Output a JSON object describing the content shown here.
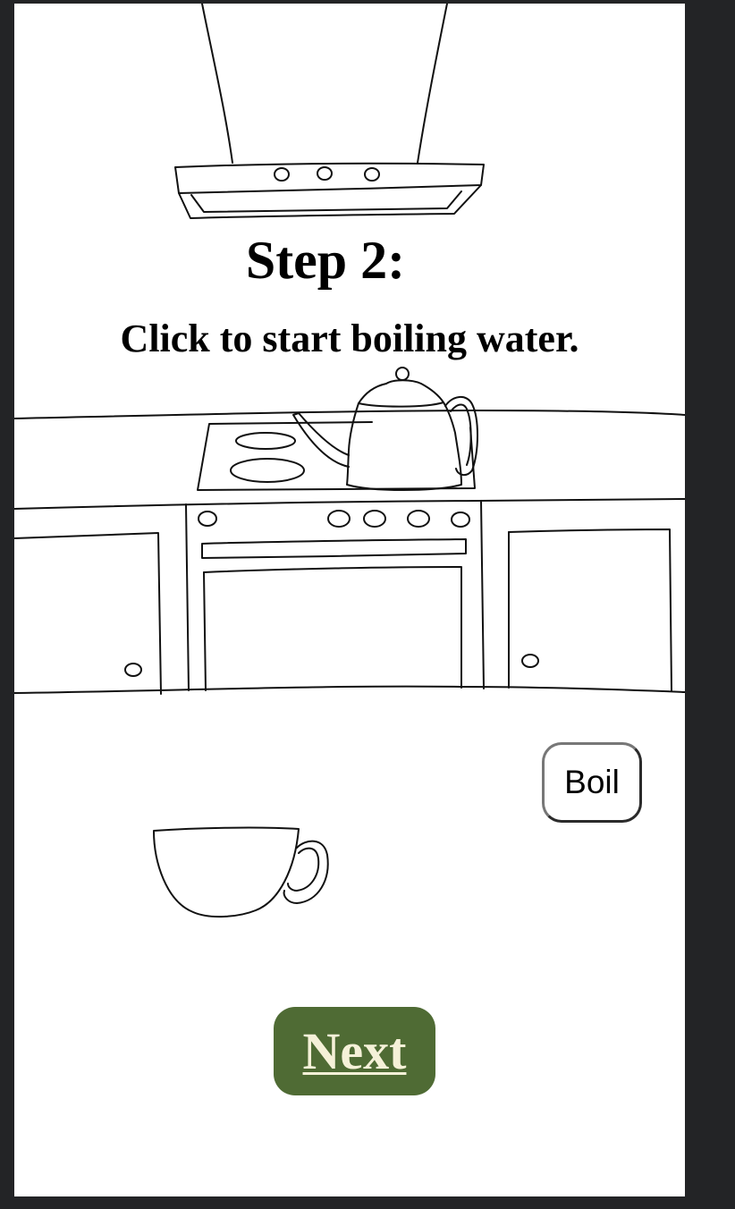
{
  "step": {
    "title": "Step 2:",
    "instruction": "Click to start boiling water."
  },
  "actions": {
    "boil_label": "Boil",
    "next_label": "Next"
  },
  "colors": {
    "next_button_bg": "#4f6b34",
    "next_button_text": "#f5f1d8",
    "outer_background": "#232426"
  },
  "illustration": {
    "items": [
      "range-hood",
      "kettle",
      "stovetop",
      "oven",
      "cabinets",
      "cup"
    ]
  }
}
